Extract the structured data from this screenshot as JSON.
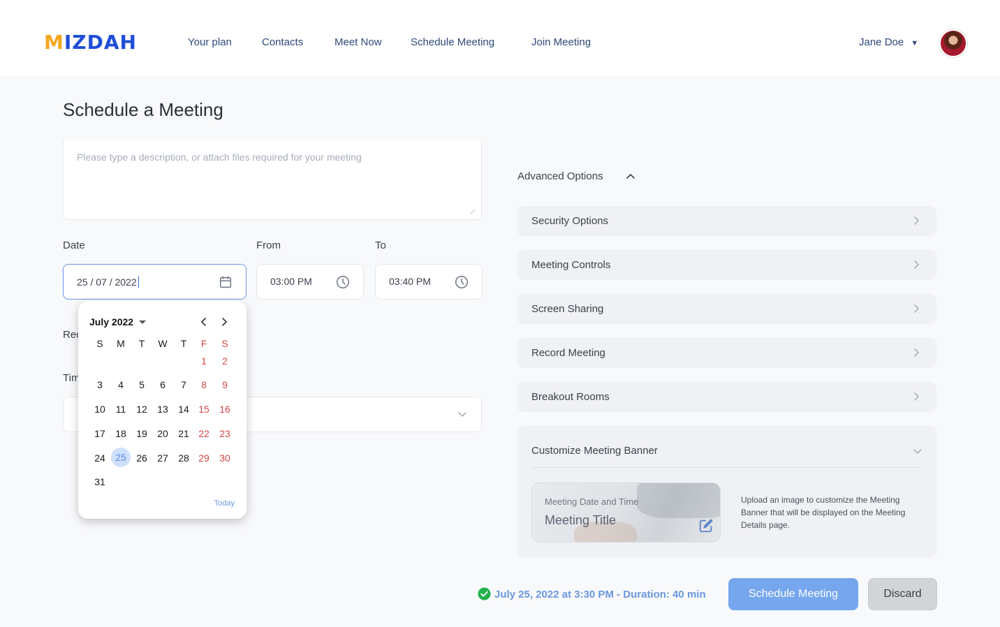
{
  "brand": {
    "logo_prefix": "M",
    "logo_rest": "IZDAH"
  },
  "nav": [
    "Your plan",
    "Contacts",
    "Meet Now",
    "Schedule Meeting",
    "Join Meeting"
  ],
  "user": {
    "name": "Jane Doe"
  },
  "page": {
    "title": "Schedule a Meeting"
  },
  "description": {
    "placeholder": "Please type a description, or attach files required for your meeting"
  },
  "date": {
    "label": "Date",
    "value": "25 / 07 / 2022"
  },
  "from": {
    "label": "From",
    "value": "03:00 PM"
  },
  "to": {
    "label": "To",
    "value": "03:40 PM"
  },
  "partial_labels": {
    "recurrence": "Rec",
    "timezone": "Tim"
  },
  "calendar": {
    "month_label": "July 2022",
    "weekday_headers": [
      "S",
      "M",
      "T",
      "W",
      "T",
      "F",
      "S"
    ],
    "weeks": [
      [
        "",
        "",
        "",
        "",
        "",
        "1",
        "2"
      ],
      [
        "3",
        "4",
        "5",
        "6",
        "7",
        "8",
        "9"
      ],
      [
        "10",
        "11",
        "12",
        "13",
        "14",
        "15",
        "16"
      ],
      [
        "17",
        "18",
        "19",
        "20",
        "21",
        "22",
        "23"
      ],
      [
        "24",
        "25",
        "26",
        "27",
        "28",
        "29",
        "30"
      ],
      [
        "31",
        "",
        "",
        "",
        "",
        "",
        ""
      ]
    ],
    "selected_day": "25",
    "today_label": "Today"
  },
  "advanced": {
    "title": "Advanced Options",
    "options": [
      "Security Options",
      "Meeting Controls",
      "Screen Sharing",
      "Record Meeting",
      "Breakout Rooms"
    ]
  },
  "banner": {
    "section_title": "Customize Meeting Banner",
    "preview_subtitle": "Meeting Date and Time",
    "preview_title": "Meeting Title",
    "help_text": "Upload an image to customize the Meeting Banner that will be displayed on the Meeting Details page."
  },
  "footer": {
    "summary": "July 25, 2022 at 3:30 PM - Duration: 40 min",
    "schedule_button": "Schedule Meeting",
    "discard_button": "Discard"
  },
  "colors": {
    "brand_blue": "#1e4fd8",
    "brand_orange": "#f4a71e",
    "accent": "#75a6ee",
    "weekend_red": "#d64545",
    "success_green": "#22b14c"
  }
}
